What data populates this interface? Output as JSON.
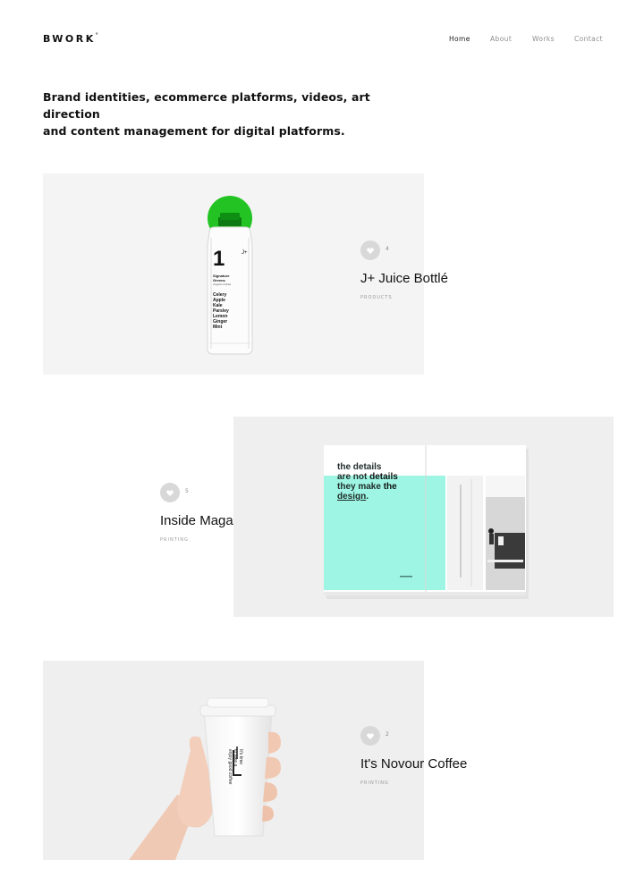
{
  "header": {
    "logo": "BWORK",
    "logo_mark": "°",
    "nav": [
      {
        "label": "Home",
        "active": true
      },
      {
        "label": "About",
        "active": false
      },
      {
        "label": "Works",
        "active": false
      },
      {
        "label": "Contact",
        "active": false
      }
    ]
  },
  "intro": {
    "line1": "Brand identities, ecommerce platforms, videos, art direction",
    "line2": "and content management for digital platforms."
  },
  "projects": [
    {
      "title": "J+ Juice Bottlé",
      "category": "PRODUCTS",
      "likes": "4",
      "image": {
        "big_number": "1",
        "brand": "J+",
        "subtitle_1": "Signature",
        "subtitle_2": "Greens",
        "subtitle_3": "Organic & Raw",
        "ingredients": [
          "Celery",
          "Apple",
          "Kale",
          "Parsley",
          "Lemon",
          "Ginger",
          "Mint"
        ],
        "cap_color": "#22c322"
      }
    },
    {
      "title": "Inside Magazine",
      "category": "PRINTING",
      "likes": "5",
      "image": {
        "line1": "the details",
        "line2_a": "are not ",
        "line2_b": "details",
        "line3_a": "they make ",
        "line3_b": "the",
        "line4": "design",
        "line4_end": ".",
        "accent_color": "#9ff5e3"
      }
    },
    {
      "title": "It's Novour Coffee",
      "category": "PRINTING",
      "likes": "2",
      "image": {
        "cup_text_1": "It's time",
        "cup_text_2": "to take a",
        "cup_text_3": "enjoy good coffee"
      }
    }
  ],
  "icons": {
    "like": "heart-icon"
  }
}
